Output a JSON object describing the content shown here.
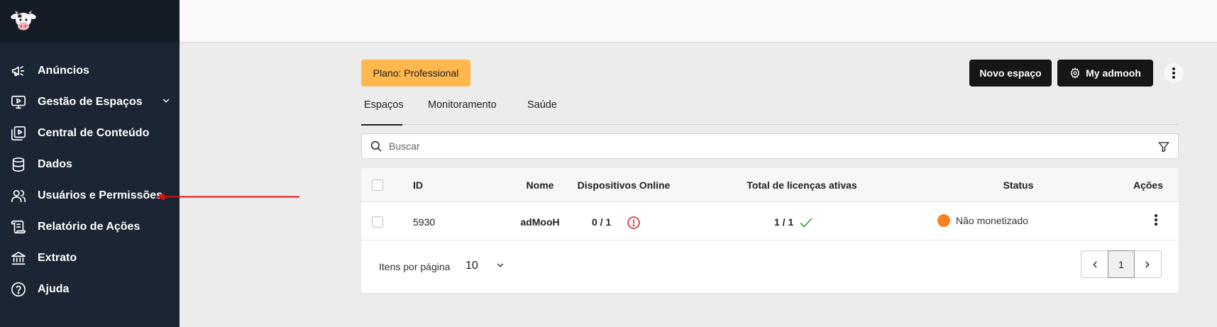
{
  "sidebar": {
    "logo": "cow-logo",
    "items": [
      {
        "label": "Anúncios",
        "icon": "megaphone-icon"
      },
      {
        "label": "Gestão de Espaços",
        "icon": "screen-play-icon",
        "has_submenu": true
      },
      {
        "label": "Central de Conteúdo",
        "icon": "media-library-icon"
      },
      {
        "label": "Dados",
        "icon": "database-icon"
      },
      {
        "label": "Usuários e Permissões",
        "icon": "users-icon"
      },
      {
        "label": "Relatório de Ações",
        "icon": "report-scroll-icon"
      },
      {
        "label": "Extrato",
        "icon": "bank-icon"
      },
      {
        "label": "Ajuda",
        "icon": "help-circle-icon"
      }
    ]
  },
  "header": {
    "plan_badge": "Plano: Professional",
    "new_space_button": "Novo espaço",
    "my_admooh_button": "My admooh"
  },
  "tabs": [
    {
      "label": "Espaços",
      "active": true
    },
    {
      "label": "Monitoramento",
      "active": false
    },
    {
      "label": "Saúde",
      "active": false
    }
  ],
  "search": {
    "placeholder": "Buscar",
    "value": ""
  },
  "table": {
    "columns": [
      "ID",
      "Nome",
      "Dispositivos Online",
      "Total de licenças ativas",
      "Status",
      "Ações"
    ],
    "rows": [
      {
        "id": "5930",
        "name": "adMooH",
        "devices_online": "0 / 1",
        "devices_status": "warning",
        "licenses": "1 / 1",
        "licenses_status": "ok",
        "status": "Não monetizado",
        "status_color": "#f58220"
      }
    ]
  },
  "pagination": {
    "items_per_page_label": "Itens por página",
    "items_per_page": "10",
    "current_page": "1"
  },
  "colors": {
    "sidebar_bg": "#1c2533",
    "plan_badge": "#ffb84d",
    "primary_button": "#161616",
    "warning_red": "#d32f2f",
    "ok_green": "#2e9e44",
    "annotation_arrow": "#e01010"
  }
}
